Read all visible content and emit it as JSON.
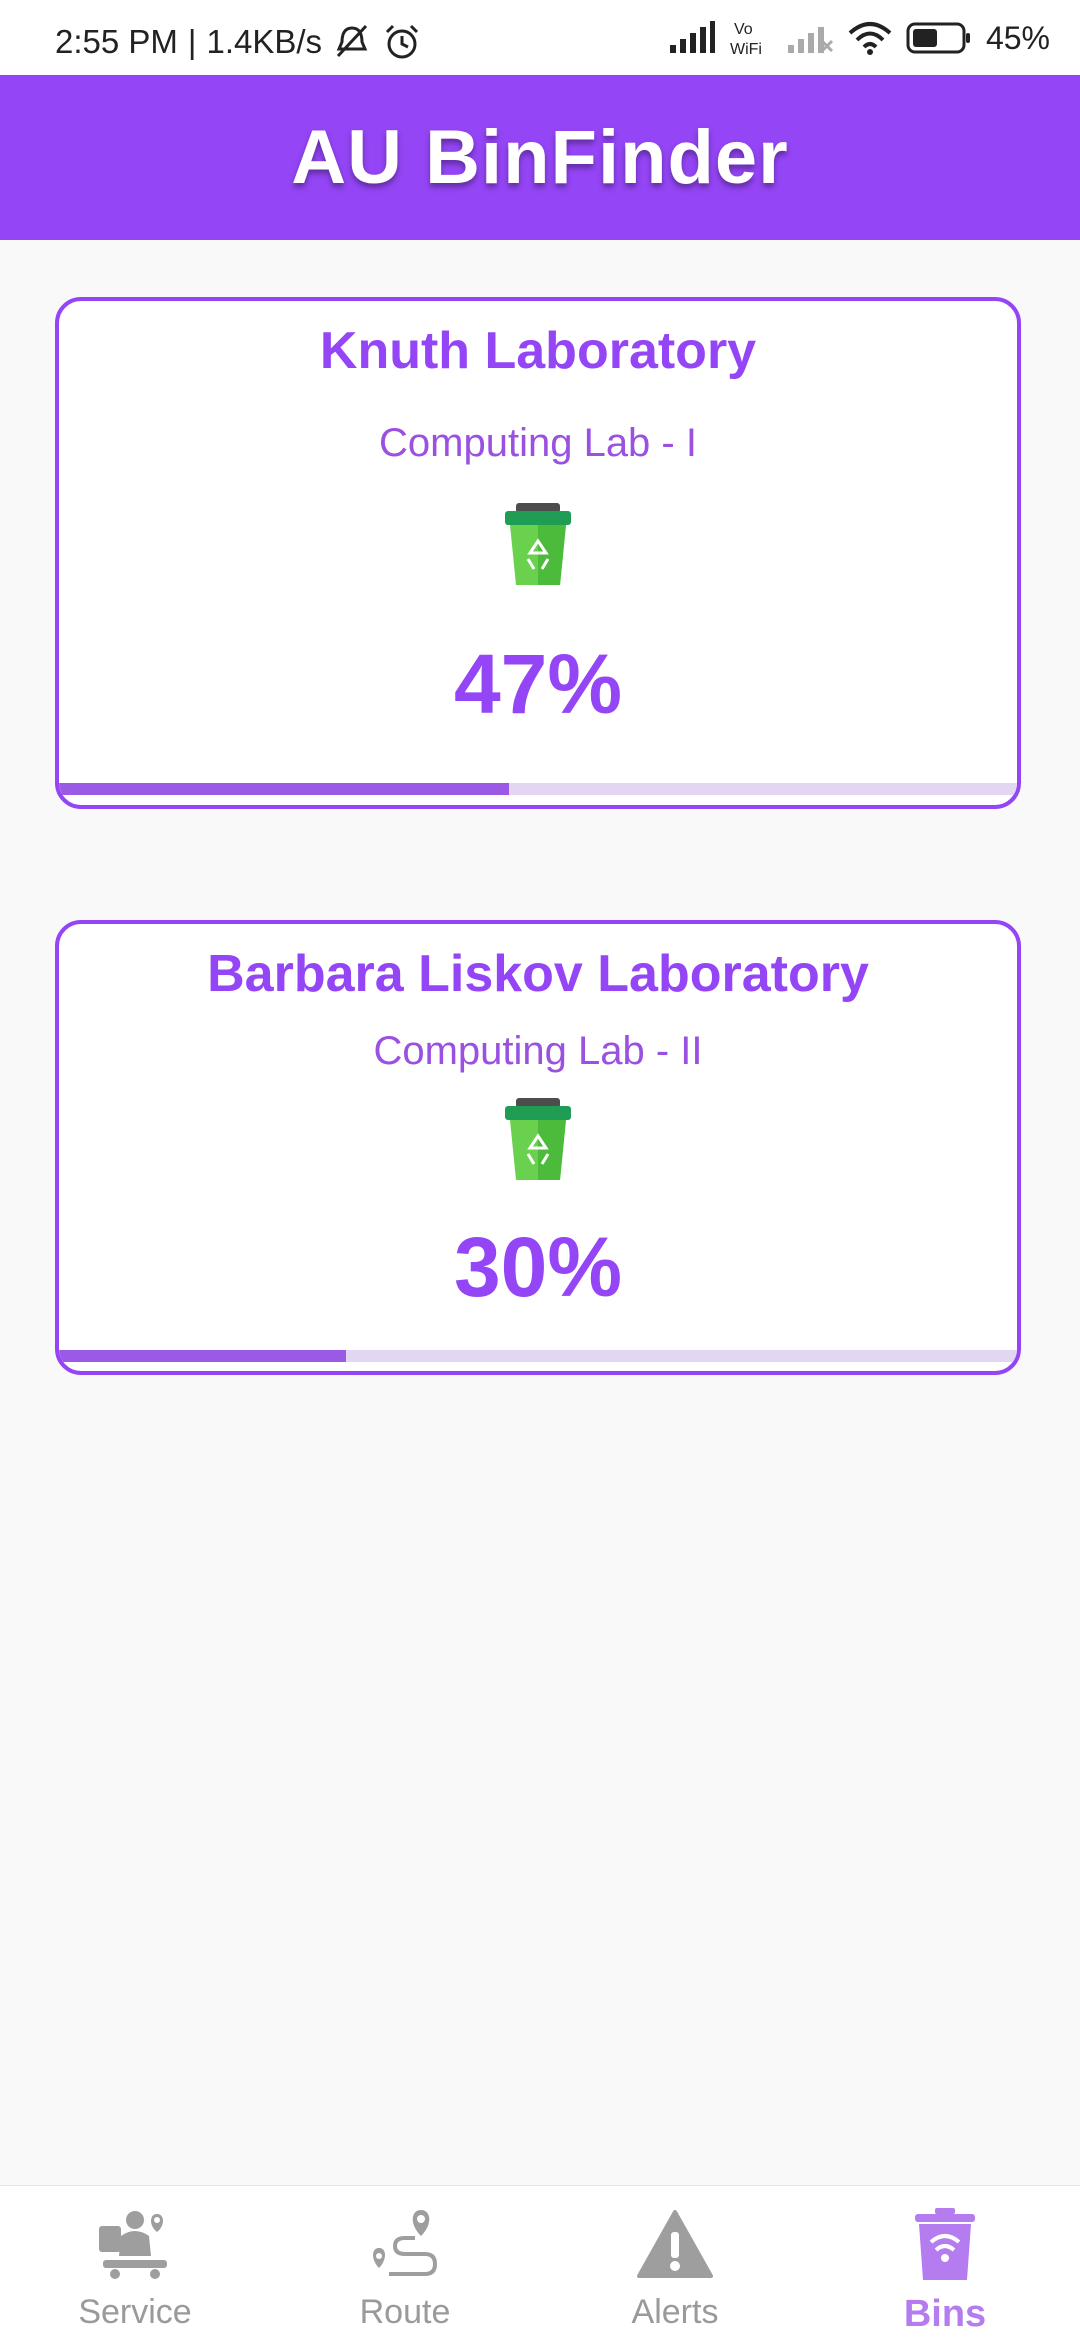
{
  "status": {
    "time": "2:55 PM",
    "network_speed": "1.4KB/s",
    "battery": "45%"
  },
  "app": {
    "title": "AU BinFinder",
    "accent": "#9445f5"
  },
  "bins": [
    {
      "name": "Knuth Laboratory",
      "location": "Computing Lab - I",
      "fill_label": "47%",
      "fill_level": 0.47
    },
    {
      "name": "Barbara Liskov Laboratory",
      "location": "Computing Lab - II",
      "fill_label": "30%",
      "fill_level": 0.3
    }
  ],
  "nav": [
    {
      "label": "Service",
      "icon": "service-icon",
      "active": false
    },
    {
      "label": "Route",
      "icon": "route-icon",
      "active": false
    },
    {
      "label": "Alerts",
      "icon": "alert-icon",
      "active": false
    },
    {
      "label": "Bins",
      "icon": "bin-icon",
      "active": true
    }
  ]
}
